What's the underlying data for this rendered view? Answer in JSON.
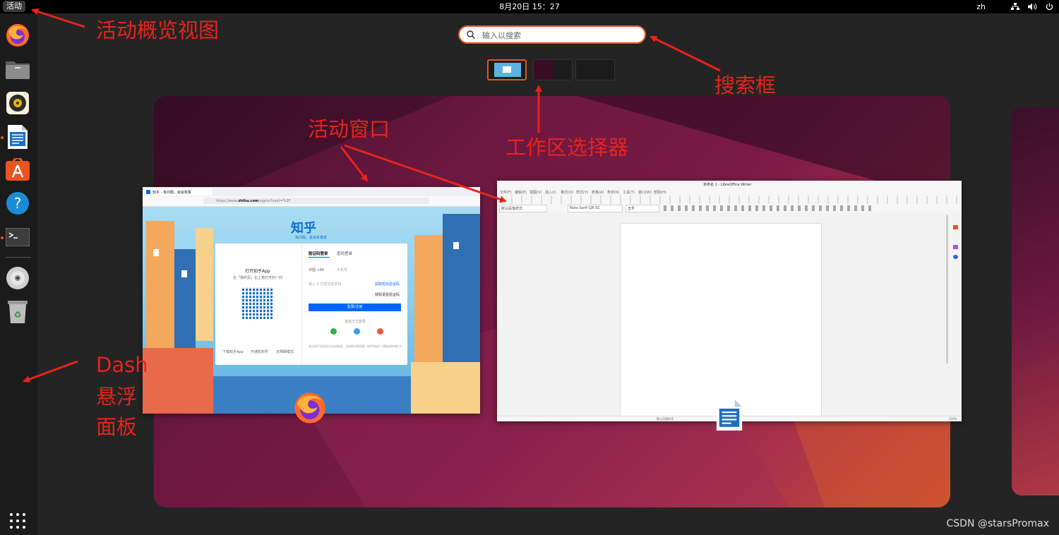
{
  "topbar": {
    "activities_label": "活动",
    "clock": "8月20日  15：27",
    "input_method": "zh",
    "icons": [
      "network-icon",
      "volume-icon",
      "power-icon"
    ]
  },
  "dash": {
    "apps": [
      {
        "name": "firefox-icon",
        "running": false
      },
      {
        "name": "files-icon",
        "running": false
      },
      {
        "name": "rhythmbox-icon",
        "running": false
      },
      {
        "name": "libreoffice-writer-icon",
        "running": true
      },
      {
        "name": "app-center-icon",
        "running": false
      },
      {
        "name": "help-icon",
        "running": false
      },
      {
        "name": "terminal-icon",
        "running": true
      }
    ],
    "devices": [
      "disc-icon",
      "trash-icon"
    ],
    "show_apps": "app-grid-icon"
  },
  "search": {
    "placeholder": "输入以搜索"
  },
  "workspaces": [
    {
      "active": true
    },
    {
      "active": false
    },
    {
      "active": false
    }
  ],
  "windows": {
    "firefox": {
      "tab_title": "知乎 - 有问题，就会有答",
      "url_prefix": "https://www.",
      "url_domain": "zhihu.com",
      "url_suffix": "/signin?next=%2F",
      "logo": "知乎",
      "slogan": "有问题，就会有答案",
      "app_title": "打开知乎App",
      "app_sub": "在「我的页」右上角打开扫一扫",
      "tab_sms": "验证码登录",
      "tab_pwd": "密码登录",
      "country": "中国 +86",
      "phone_ph": "手机号",
      "sms_ph": "输入 6 位短信验证码",
      "get_code": "获取短信验证码",
      "voice_code": "获取语音验证码",
      "login_btn": "登录/注册",
      "other": "其他方式登录",
      "bottom_links": [
        "下载知乎App",
        "开通机构号",
        "无障碍模式"
      ],
      "terms": "未注册手机验证后自动登录，注册即代表同意《知乎协议》《隐私保护指引》"
    },
    "writer": {
      "title": "未命名 1 - LibreOffice Writer",
      "menus": [
        "文件(F)",
        "编辑(E)",
        "视图(V)",
        "插入(I)",
        "格式(O)",
        "样式(Y)",
        "表格(A)",
        "表单(R)",
        "工具(T)",
        "窗口(W)",
        "帮助(H)"
      ],
      "para_style": "默认段落样式",
      "font": "Noto Serif CJK SC",
      "size": "五号",
      "status_style": "默认页面样式",
      "zoom": "100%"
    }
  },
  "annotations": {
    "overview": "活动概览视图",
    "search": "搜索框",
    "windows": "活动窗口",
    "workspace": "工作区选择器",
    "dash_line1": "Dash",
    "dash_line2": "悬浮",
    "dash_line3": "面板",
    "color": "#e8231d"
  },
  "watermark": "CSDN @starsPromax"
}
